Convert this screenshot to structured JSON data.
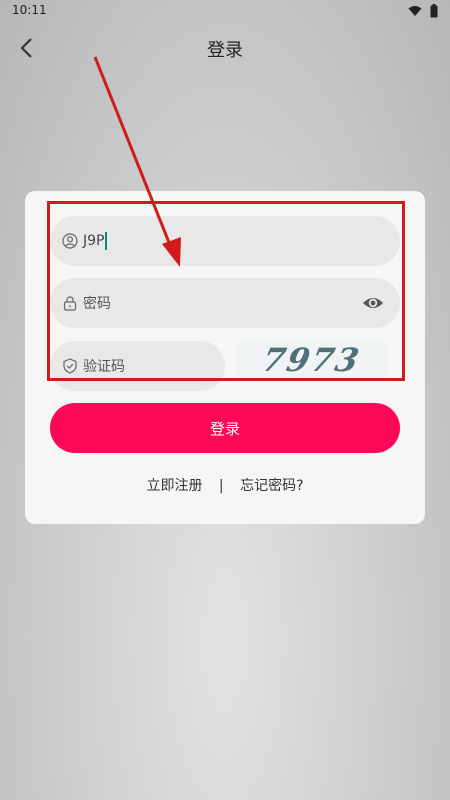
{
  "status_bar": {
    "time": "10:11",
    "icons": [
      "wifi-icon",
      "battery-icon"
    ]
  },
  "header": {
    "title": "登录",
    "back_icon": "chevron-left-icon"
  },
  "form": {
    "username": {
      "value": "J9P",
      "icon": "user-circle-icon"
    },
    "password": {
      "placeholder": "密码",
      "icon": "lock-icon",
      "toggle_icon": "eye-icon"
    },
    "captcha": {
      "placeholder": "验证码",
      "icon": "shield-icon",
      "image_text": "7973"
    },
    "login_button": "登录",
    "register_link": "立即注册",
    "separator": "|",
    "forgot_link": "忘记密码?"
  },
  "colors": {
    "accent": "#fb0856",
    "annotation": "#d11a1a",
    "cursor": "#0a8a77"
  }
}
